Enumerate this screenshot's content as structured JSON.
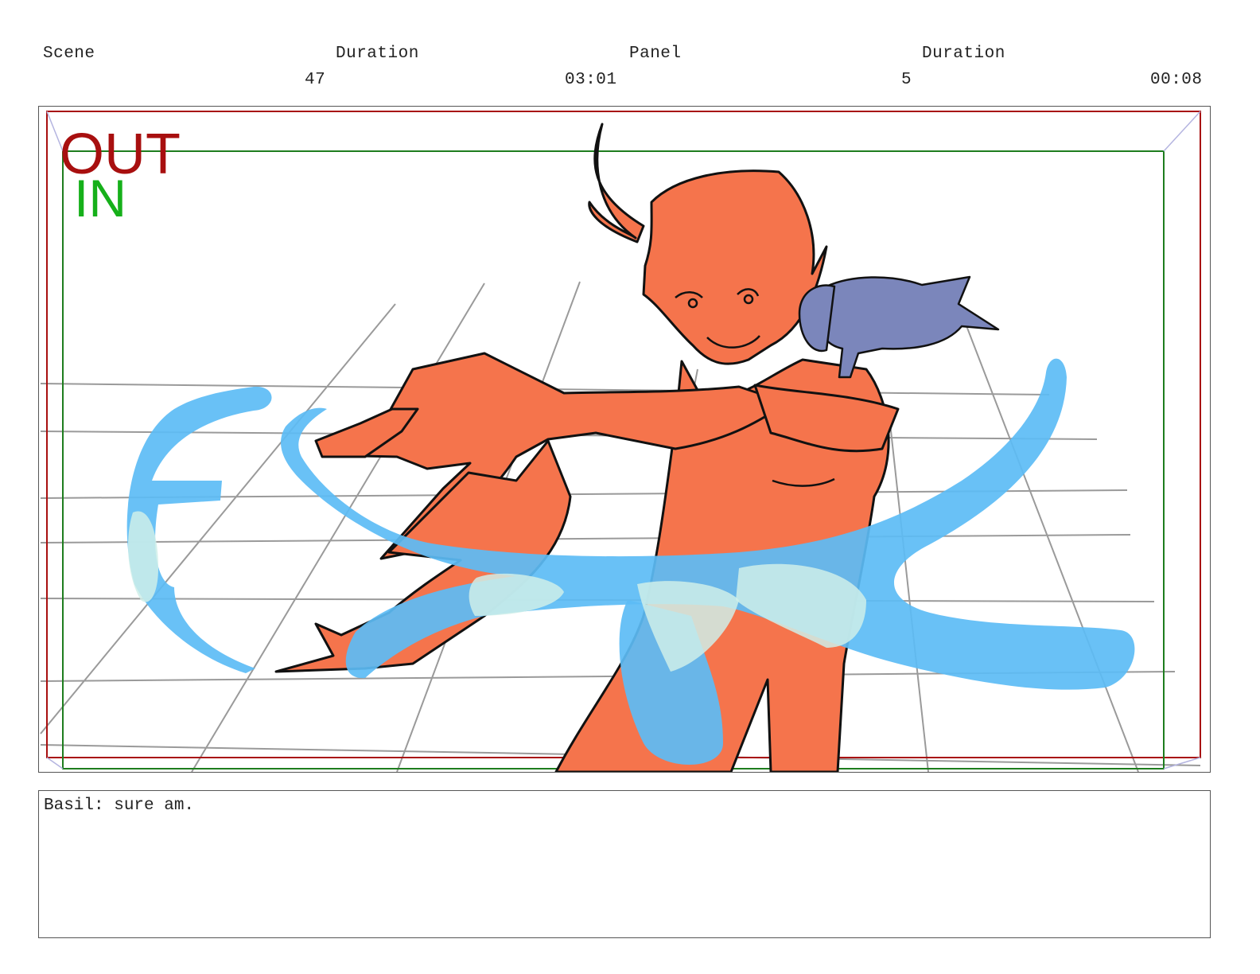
{
  "header": {
    "scene_label": "Scene",
    "scene_value": "47",
    "scene_duration_label": "Duration",
    "scene_duration_value": "03:01",
    "panel_label": "Panel",
    "panel_value": "5",
    "panel_duration_label": "Duration",
    "panel_duration_value": "00:08"
  },
  "panel": {
    "out_label": "OUT",
    "in_label": "IN",
    "out_color": "#a80f0f",
    "in_color": "#16b01a",
    "character_color": "#f5744c",
    "water_color": "#5cbcf5",
    "creature_color": "#7b86bb"
  },
  "notes": {
    "dialogue": "Basil: sure am."
  }
}
